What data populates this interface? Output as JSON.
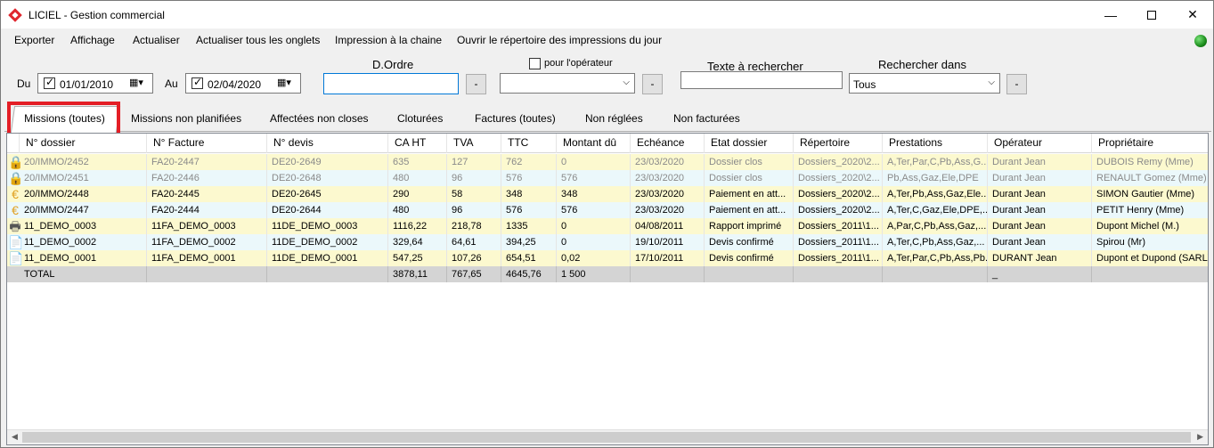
{
  "window": {
    "title": "LICIEL - Gestion commercial"
  },
  "menu": [
    "Exporter",
    "Affichage",
    "Actualiser",
    "Actualiser tous les onglets",
    "Impression à la chaine",
    "Ouvrir le répertoire des impressions du jour"
  ],
  "filters": {
    "du_label": "Du",
    "date_from": "01/01/2010",
    "au_label": "Au",
    "date_to": "02/04/2020",
    "dordre_label": "D.Ordre",
    "dordre_value": "",
    "dash": "-",
    "pour_operateur_label": "pour l'opérateur",
    "operator_value": "",
    "texte_label": "Texte à rechercher",
    "texte_value": "",
    "rechercher_dans_label": "Rechercher dans",
    "rechercher_dans_value": "Tous"
  },
  "tabs": [
    "Missions (toutes)",
    "Missions non planifiées",
    "Affectées non closes",
    "Cloturées",
    "Factures (toutes)",
    "Non réglées",
    "Non facturées"
  ],
  "table": {
    "columns": [
      "N° dossier",
      "N° Facture",
      "N° devis",
      "CA HT",
      "TVA",
      "TTC",
      "Montant dû",
      "Echéance",
      "Etat dossier",
      "Répertoire",
      "Prestations",
      "Opérateur",
      "Propriétaire"
    ],
    "rows": [
      {
        "icon": "lock-icon",
        "cells": [
          "20/IMMO/2452",
          "FA20-2447",
          "DE20-2649",
          "635",
          "127",
          "762",
          "0",
          "23/03/2020",
          "Dossier clos",
          "Dossiers_2020\\2...",
          "A,Ter,Par,C,Pb,Ass,G...",
          "Durant Jean",
          "DUBOIS Remy (Mme)"
        ]
      },
      {
        "icon": "lock-icon",
        "cells": [
          "20/IMMO/2451",
          "FA20-2446",
          "DE20-2648",
          "480",
          "96",
          "576",
          "576",
          "23/03/2020",
          "Dossier clos",
          "Dossiers_2020\\2...",
          "Pb,Ass,Gaz,Ele,DPE",
          "Durant Jean",
          "RENAULT Gomez (Mme)"
        ]
      },
      {
        "icon": "euro-icon",
        "cells": [
          "20/IMMO/2448",
          "FA20-2445",
          "DE20-2645",
          "290",
          "58",
          "348",
          "348",
          "23/03/2020",
          "Paiement en att...",
          "Dossiers_2020\\2...",
          "A,Ter,Pb,Ass,Gaz,Ele...",
          "Durant Jean",
          "SIMON Gautier (Mme)"
        ]
      },
      {
        "icon": "euro-icon",
        "cells": [
          "20/IMMO/2447",
          "FA20-2444",
          "DE20-2644",
          "480",
          "96",
          "576",
          "576",
          "23/03/2020",
          "Paiement en att...",
          "Dossiers_2020\\2...",
          "A,Ter,C,Gaz,Ele,DPE,...",
          "Durant Jean",
          "PETIT Henry (Mme)"
        ]
      },
      {
        "icon": "printer-icon",
        "cells": [
          "11_DEMO_0003",
          "11FA_DEMO_0003",
          "11DE_DEMO_0003",
          "1116,22",
          "218,78",
          "1335",
          "0",
          "04/08/2011",
          "Rapport imprimé",
          "Dossiers_2011\\1...",
          "A,Par,C,Pb,Ass,Gaz,...",
          "Durant Jean",
          "Dupont Michel (M.)"
        ]
      },
      {
        "icon": "quote-icon",
        "cells": [
          "11_DEMO_0002",
          "11FA_DEMO_0002",
          "11DE_DEMO_0002",
          "329,64",
          "64,61",
          "394,25",
          "0",
          "19/10/2011",
          "Devis confirmé",
          "Dossiers_2011\\1...",
          "A,Ter,C,Pb,Ass,Gaz,...",
          "Durant Jean",
          "Spirou (Mr)"
        ]
      },
      {
        "icon": "quote-icon",
        "cells": [
          "11_DEMO_0001",
          "11FA_DEMO_0001",
          "11DE_DEMO_0001",
          "547,25",
          "107,26",
          "654,51",
          "0,02",
          "17/10/2011",
          "Devis confirmé",
          "Dossiers_2011\\1...",
          "A,Ter,Par,C,Pb,Ass,Pb...",
          "DURANT Jean",
          "Dupont et Dupond (SARL)"
        ]
      }
    ],
    "total": [
      "TOTAL",
      "",
      "",
      "3878,11",
      "767,65",
      "4645,76",
      "1 500",
      "",
      "",
      "",
      "",
      "_",
      ""
    ]
  }
}
